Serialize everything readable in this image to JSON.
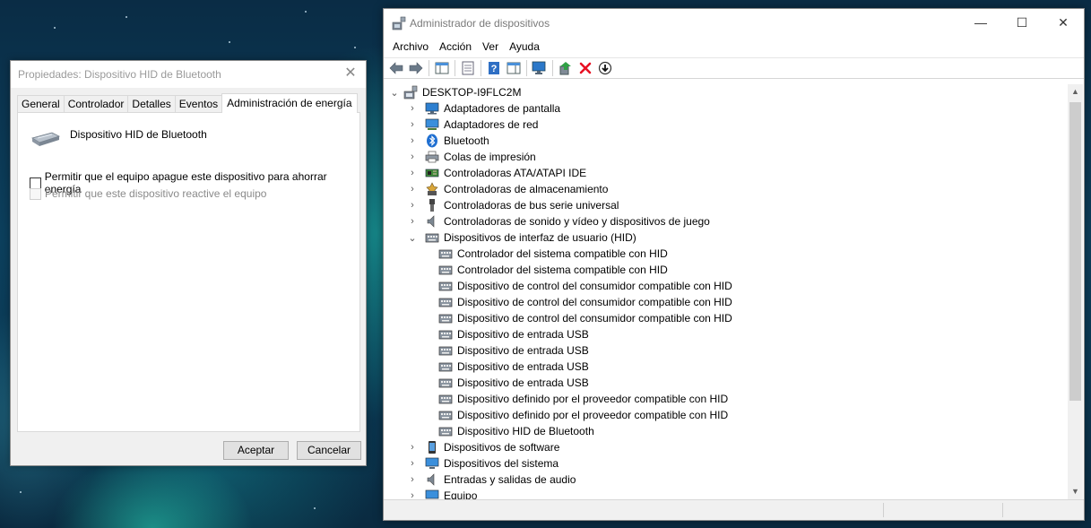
{
  "dialog": {
    "title": "Propiedades: Dispositivo HID de Bluetooth",
    "tabs": [
      "General",
      "Controlador",
      "Detalles",
      "Eventos",
      "Administración de energía"
    ],
    "active_tab": "Administración de energía",
    "device_name": "Dispositivo HID de Bluetooth",
    "option_allow_turn_off": "Permitir que el equipo apague este dispositivo para ahorrar energía",
    "option_allow_wake": "Permitir que este dispositivo reactive el equipo",
    "ok_label": "Aceptar",
    "cancel_label": "Cancelar"
  },
  "device_manager": {
    "title": "Administrador de dispositivos",
    "menu": [
      "Archivo",
      "Acción",
      "Ver",
      "Ayuda"
    ],
    "computer": "DESKTOP-I9FLC2M",
    "categories": [
      "Adaptadores de pantalla",
      "Adaptadores de red",
      "Bluetooth",
      "Colas de impresión",
      "Controladoras ATA/ATAPI IDE",
      "Controladoras de almacenamiento",
      "Controladoras de bus serie universal",
      "Controladoras de sonido y vídeo y dispositivos de juego",
      "Dispositivos de interfaz de usuario (HID)"
    ],
    "hid_devices": [
      "Controlador del sistema compatible con HID",
      "Controlador del sistema compatible con HID",
      "Dispositivo de control del consumidor compatible con HID",
      "Dispositivo de control del consumidor compatible con HID",
      "Dispositivo de control del consumidor compatible con HID",
      "Dispositivo de entrada USB",
      "Dispositivo de entrada USB",
      "Dispositivo de entrada USB",
      "Dispositivo de entrada USB",
      "Dispositivo definido por el proveedor compatible con HID",
      "Dispositivo definido por el proveedor compatible con HID",
      "Dispositivo HID de Bluetooth"
    ],
    "more_categories": [
      "Dispositivos de software",
      "Dispositivos del sistema",
      "Entradas y salidas de audio",
      "Equipo"
    ]
  },
  "colors": {
    "accent": "#0078d7",
    "delete_red": "#e81123"
  }
}
